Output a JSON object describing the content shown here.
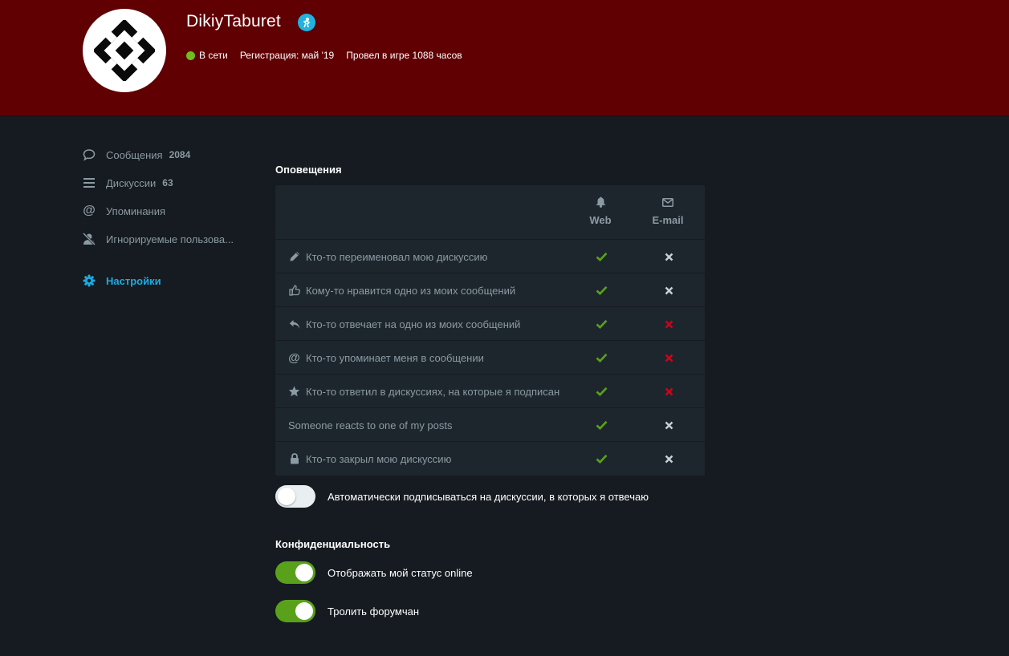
{
  "profile": {
    "username": "DikiyTaburet",
    "status": "В сети",
    "registration": "Регистрация: май '19",
    "playtime": "Провел в игре 1088 часов",
    "avatar_icon": "diamond-logo-icon",
    "badge_icon": "staff-badge-icon"
  },
  "colors": {
    "header_bg": "#600003",
    "page_bg": "#151b20",
    "accent": "#1fa9e1",
    "online": "#6fbd1f",
    "check": "#5aa11b",
    "cross_red": "#d0021b",
    "cross_gray": "#c6d0d6"
  },
  "sidebar": {
    "items": [
      {
        "label": "Сообщения",
        "count": "2084",
        "icon": "speech-bubble-icon"
      },
      {
        "label": "Дискуссии",
        "count": "63",
        "icon": "list-icon"
      },
      {
        "label": "Упоминания",
        "count": "",
        "icon": "at-sign-icon"
      },
      {
        "label": "Игнорируемые пользова...",
        "count": "",
        "icon": "user-slash-icon"
      },
      {
        "label": "Настройки",
        "count": "",
        "icon": "gear-icon",
        "active": true
      }
    ]
  },
  "notifications": {
    "title": "Оповещения",
    "columns": {
      "web": "Web",
      "email": "E-mail"
    },
    "rows": [
      {
        "label": "Кто-то переименовал мою дискуссию",
        "icon": "pencil-icon",
        "web": true,
        "email": false,
        "email_style": "gray"
      },
      {
        "label": "Кому-то нравится одно из моих сообщений",
        "icon": "thumbs-up-icon",
        "web": true,
        "email": false,
        "email_style": "gray"
      },
      {
        "label": "Кто-то отвечает на одно из моих сообщений",
        "icon": "reply-icon",
        "web": true,
        "email": false,
        "email_style": "red"
      },
      {
        "label": "Кто-то упоминает меня в сообщении",
        "icon": "at-sign-icon",
        "web": true,
        "email": false,
        "email_style": "red"
      },
      {
        "label": "Кто-то ответил в дискуссиях, на которые я подписан",
        "icon": "star-icon",
        "web": true,
        "email": false,
        "email_style": "red"
      },
      {
        "label": "Someone reacts to one of my posts",
        "icon": "",
        "web": true,
        "email": false,
        "email_style": "gray"
      },
      {
        "label": "Кто-то закрыл мою дискуссию",
        "icon": "lock-icon",
        "web": true,
        "email": false,
        "email_style": "gray"
      }
    ],
    "auto_subscribe": {
      "label": "Автоматически подписываться на дискуссии, в которых я отвечаю",
      "on": false
    }
  },
  "privacy": {
    "title": "Конфиденциальность",
    "toggles": [
      {
        "label": "Отображать мой статус online",
        "on": true
      },
      {
        "label": "Тролить форумчан",
        "on": true
      }
    ]
  }
}
